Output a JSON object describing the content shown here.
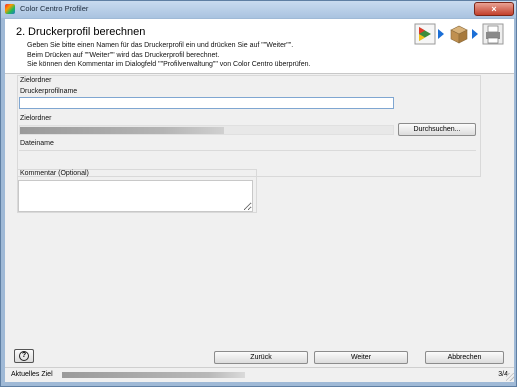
{
  "window": {
    "title": "Color Centro Profiler",
    "close_label": "×"
  },
  "header": {
    "step_number": "2.",
    "step_title": "Druckerprofil berechnen",
    "instructions": [
      "Geben Sie bitte einen Namen für das Druckerprofil ein und drücken Sie auf \"\"Weiter\"\".",
      "Beim Drücken auf \"\"Weiter\"\" wird das Druckerprofil berechnet.",
      "Sie können den Kommentar im Dialogfeld \"\"Profilverwaltung\"\" von Color Centro überprüfen."
    ],
    "steps": [
      "step-chart-icon",
      "step-package-icon",
      "step-printer-icon"
    ]
  },
  "target_group": {
    "title": "Zielordner",
    "profile_name_label": "Druckerprofilname",
    "profile_name_value": "",
    "folder_label": "Zielordner",
    "browse_label": "Durchsuchen...",
    "filename_label": "Dateiname"
  },
  "comment": {
    "label": "Kommentar (Optional)",
    "value": ""
  },
  "buttons": {
    "help": "?",
    "back": "Zurück",
    "next": "Weiter",
    "cancel": "Abbrechen"
  },
  "status": {
    "label": "Aktuelles Ziel",
    "page": "3/4"
  },
  "colors": {
    "window_frame": "#9fb9d6",
    "close_button": "#c2402c",
    "step_arrow": "#1b6fd6",
    "input_border": "#7fa6d1"
  }
}
